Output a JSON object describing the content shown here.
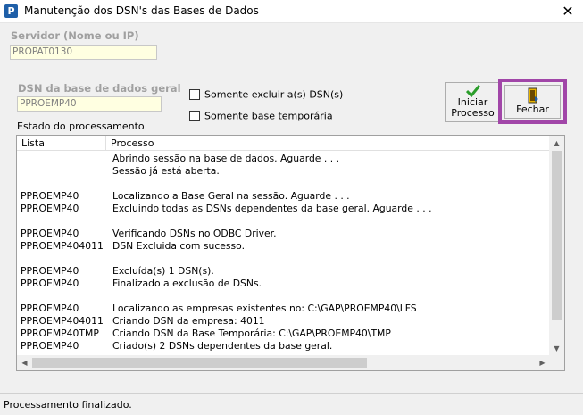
{
  "window": {
    "title": "Manutenção dos DSN's das Bases de Dados",
    "close_glyph": "✕",
    "icon_letter": "P"
  },
  "server": {
    "label": "Servidor (Nome ou IP)",
    "value": "PROPAT0130"
  },
  "dsn_general": {
    "label": "DSN da base de dados geral",
    "value": "PPROEMP40"
  },
  "options": {
    "only_delete_label": "Somente excluir a(s) DSN(s)",
    "only_temp_label": "Somente base temporária"
  },
  "buttons": {
    "start_line1": "Iniciar",
    "start_line2": "Processo",
    "close_label": "Fechar"
  },
  "processing": {
    "section_label": "Estado do processamento",
    "columns": [
      "Lista",
      "Processo"
    ],
    "rows": [
      {
        "lista": "",
        "processo": "Abrindo sessão na base de dados. Aguarde . . ."
      },
      {
        "lista": "",
        "processo": "Sessão já está aberta."
      },
      {
        "lista": "",
        "processo": ""
      },
      {
        "lista": "PPROEMP40",
        "processo": "Localizando a Base Geral na sessão. Aguarde . . ."
      },
      {
        "lista": "PPROEMP40",
        "processo": "Excluindo todas as DSNs dependentes da base geral. Aguarde . . ."
      },
      {
        "lista": "",
        "processo": ""
      },
      {
        "lista": "PPROEMP40",
        "processo": "Verificando DSNs no ODBC Driver."
      },
      {
        "lista": "PPROEMP404011",
        "processo": "DSN Excluida com sucesso."
      },
      {
        "lista": "",
        "processo": ""
      },
      {
        "lista": "PPROEMP40",
        "processo": "Excluída(s) 1 DSN(s)."
      },
      {
        "lista": "PPROEMP40",
        "processo": "Finalizado a exclusão de DSNs."
      },
      {
        "lista": "",
        "processo": ""
      },
      {
        "lista": "PPROEMP40",
        "processo": "Localizando as empresas existentes no: C:\\GAP\\PROEMP40\\LFS"
      },
      {
        "lista": "PPROEMP404011",
        "processo": "Criando DSN da empresa: 4011"
      },
      {
        "lista": "PPROEMP40TMP",
        "processo": "Criando DSN da Base Temporária: C:\\GAP\\PROEMP40\\TMP"
      },
      {
        "lista": "PPROEMP40",
        "processo": "Criado(s) 2 DSNs dependentes da base geral."
      }
    ]
  },
  "status": {
    "text": "Processamento finalizado."
  },
  "colors": {
    "highlight": "#a146a8",
    "input_bg": "#ffffe1",
    "check_green": "#2a9d2a",
    "door_yellow": "#e8b400"
  }
}
